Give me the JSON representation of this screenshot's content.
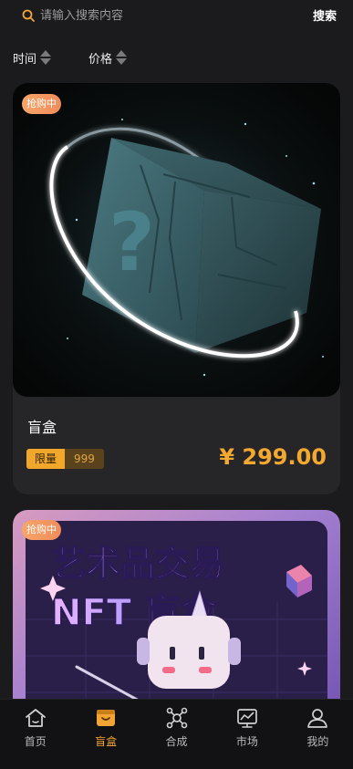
{
  "search": {
    "placeholder": "请输入搜索内容",
    "button_label": "搜索"
  },
  "sort": {
    "items": [
      {
        "label": "时间"
      },
      {
        "label": "价格"
      }
    ]
  },
  "products": [
    {
      "status": "抢购中",
      "title": "盲盒",
      "limit_label": "限量",
      "limit_value": "999",
      "price": "¥ 299.00"
    },
    {
      "status": "抢购中",
      "poster_line1": "艺术品交易",
      "poster_line2": "NFT 盲盒"
    }
  ],
  "nav": {
    "items": [
      {
        "label": "首页",
        "icon": "home-icon"
      },
      {
        "label": "盲盒",
        "icon": "box-icon",
        "active": true
      },
      {
        "label": "合成",
        "icon": "synthesis-icon"
      },
      {
        "label": "市场",
        "icon": "market-icon"
      },
      {
        "label": "我的",
        "icon": "user-icon"
      }
    ]
  },
  "colors": {
    "background": "#1b1b1d",
    "card": "#262628",
    "accent": "#f2a534",
    "badge": "#f29a60"
  }
}
